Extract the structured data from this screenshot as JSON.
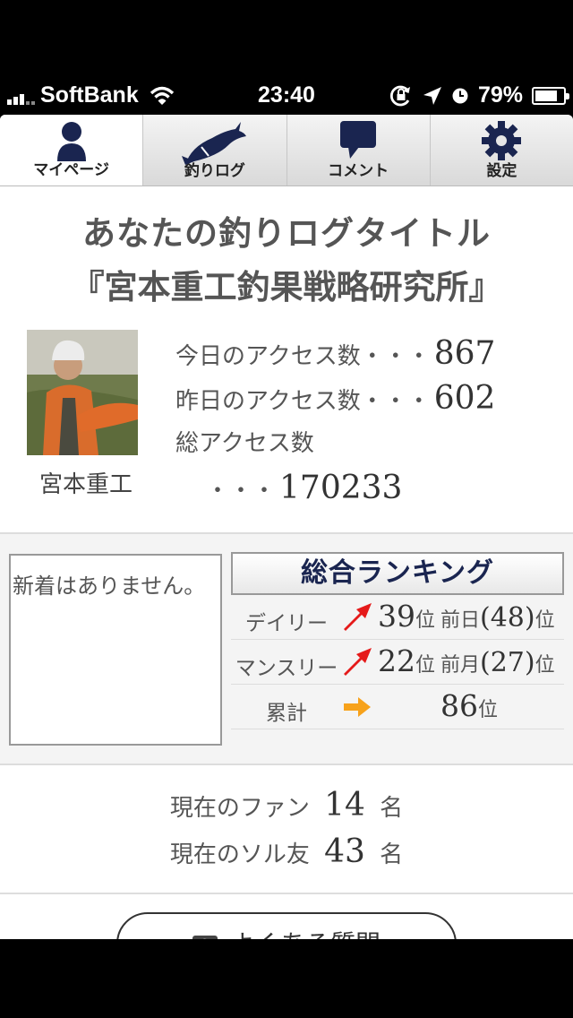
{
  "status_bar": {
    "carrier": "SoftBank",
    "time": "23:40",
    "battery_percent": "79%",
    "battery_level": 0.79,
    "icons": [
      "signal-icon",
      "wifi-icon",
      "rotation-lock-icon",
      "location-icon",
      "alarm-icon",
      "battery-icon"
    ]
  },
  "tabs": [
    {
      "label": "マイページ",
      "icon": "person-icon",
      "active": true
    },
    {
      "label": "釣りログ",
      "icon": "fish-icon",
      "active": false
    },
    {
      "label": "コメント",
      "icon": "comment-bubble-icon",
      "active": false
    },
    {
      "label": "設定",
      "icon": "gear-icon",
      "active": false
    }
  ],
  "header": {
    "title_line1": "あなたの釣りログタイトル",
    "title_line2": "『宮本重工釣果戦略研究所』"
  },
  "profile": {
    "username": "宮本重工",
    "today_label": "今日のアクセス数・・・",
    "today_value": "867",
    "yesterday_label": "昨日のアクセス数・・・",
    "yesterday_value": "602",
    "total_label": "総アクセス数",
    "total_prefix": "・・・",
    "total_value": "170233"
  },
  "news": {
    "text": "新着はありません。"
  },
  "ranking": {
    "title": "総合ランキング",
    "rows": [
      {
        "label": "デイリー",
        "arrow": "up-arrow-icon",
        "rank": "39",
        "unit": "位",
        "prev_label": "前日",
        "prev_value": "(48)",
        "prev_unit": "位"
      },
      {
        "label": "マンスリー",
        "arrow": "up-arrow-icon",
        "rank": "22",
        "unit": "位",
        "prev_label": "前月",
        "prev_value": "(27)",
        "prev_unit": "位"
      },
      {
        "label": "累計",
        "arrow": "right-arrow-icon",
        "rank": "86",
        "unit": "位"
      }
    ]
  },
  "fans": {
    "fan_label": "現在のファン",
    "fan_count": "14",
    "fan_unit": "名",
    "friend_label": "現在のソル友",
    "friend_count": "43",
    "friend_unit": "名"
  },
  "faq": {
    "icon": "question-icon",
    "label": "よくある質問"
  }
}
